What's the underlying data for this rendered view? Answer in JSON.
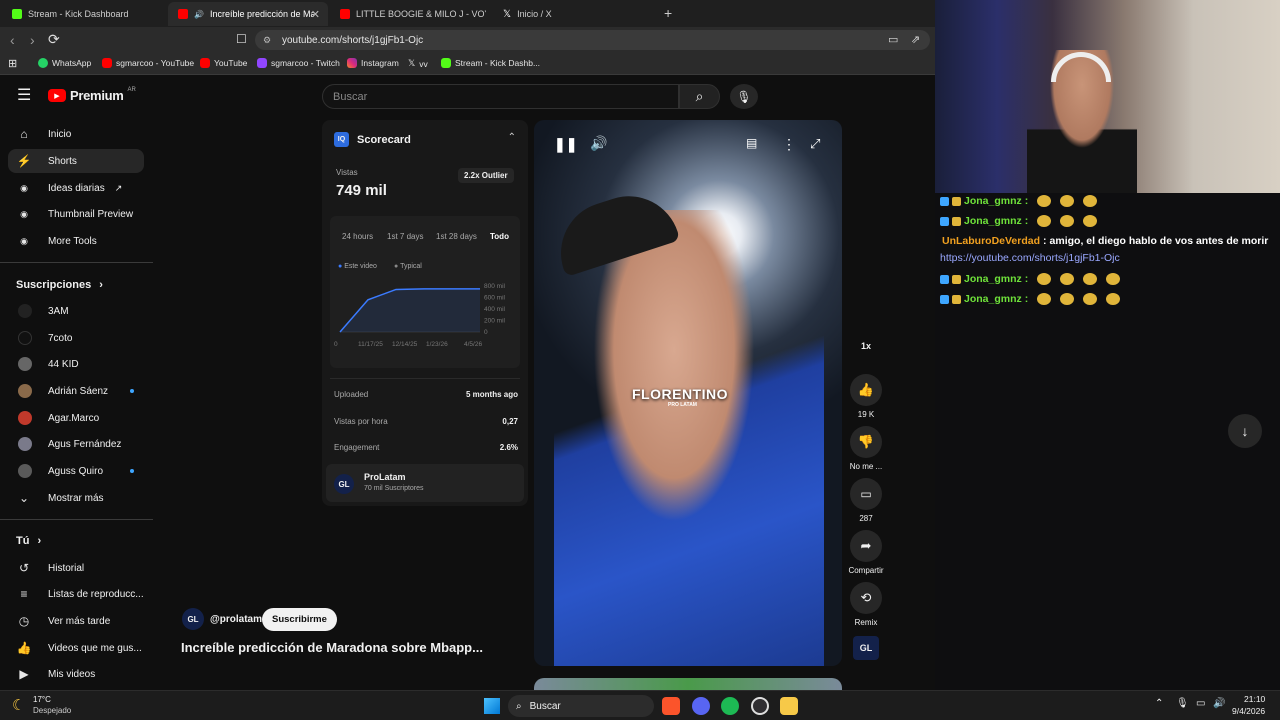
{
  "browser": {
    "tabs": [
      {
        "label": "Stream - Kick Dashboard",
        "color": "#53fc18"
      },
      {
        "label": "Increíble predicción de Marad",
        "color": "#ff0000"
      },
      {
        "label": "LITTLE BOOGIE & MILO J - VOY A DI",
        "color": "#ff0000"
      },
      {
        "label": "Inicio / X",
        "color": "#ffffff"
      }
    ],
    "url": "youtube.com/shorts/j1gjFb1-Ojc",
    "bookmarks": [
      "WhatsApp",
      "sgmarcoo - YouTube",
      "YouTube",
      "sgmarcoo - Twitch",
      "Instagram",
      "vv",
      "Stream - Kick Dashb..."
    ]
  },
  "yt": {
    "logo": "Premium",
    "region": "AR",
    "search_placeholder": "Buscar",
    "nav": [
      {
        "label": "Inicio"
      },
      {
        "label": "Shorts"
      },
      {
        "label": "Ideas diarias"
      },
      {
        "label": "Thumbnail Preview"
      },
      {
        "label": "More Tools"
      }
    ],
    "subs_title": "Suscripciones",
    "subs": [
      {
        "label": "3AM",
        "color": "#222222"
      },
      {
        "label": "7coto",
        "color": "#111111"
      },
      {
        "label": "44 KID",
        "color": "#666666"
      },
      {
        "label": "Adrián Sáenz",
        "color": "#8a6a4a"
      },
      {
        "label": "Agar.Marco",
        "color": "#c0392b"
      },
      {
        "label": "Agus Fernández",
        "color": "#7a7a8a"
      },
      {
        "label": "Aguss Quiro",
        "color": "#5a5a5a"
      }
    ],
    "show_more": "Mostrar más",
    "you_title": "Tú",
    "you": [
      {
        "label": "Historial"
      },
      {
        "label": "Listas de reproducc..."
      },
      {
        "label": "Ver más tarde"
      },
      {
        "label": "Videos que me gus..."
      },
      {
        "label": "Mis videos"
      }
    ]
  },
  "scorecard": {
    "badge": "IQ",
    "title": "Scorecard",
    "views_label": "Vistas",
    "views": "749 mil",
    "outlier": "2.2x Outlier",
    "ranges": [
      "24 hours",
      "1st 7 days",
      "1st 28 days",
      "Todo"
    ],
    "legend": [
      "Este video",
      "Typical"
    ],
    "y_ticks": [
      "800 mil",
      "600 mil",
      "400 mil",
      "200 mil",
      "0"
    ],
    "x_ticks": [
      "0",
      "11/17/25",
      "12/14/25",
      "1/23/26",
      "4/5/26"
    ],
    "stats": [
      {
        "label": "Uploaded",
        "value": "5 months ago"
      },
      {
        "label": "Vistas por hora",
        "value": "0,27"
      },
      {
        "label": "Engagement",
        "value": "2.6%"
      }
    ],
    "channel_name": "ProLatam",
    "channel_subs": "70 mil Suscriptores",
    "channel_logo": "GL"
  },
  "chart_data": {
    "type": "line",
    "series": [
      {
        "name": "Este video",
        "values": [
          0,
          560,
          740,
          749,
          749,
          749
        ]
      }
    ],
    "x": [
      "0",
      "11/17/25",
      "12/14/25",
      "1/23/26",
      "4/5/26"
    ],
    "ylim": [
      0,
      800
    ]
  },
  "video": {
    "overlay_title": "FLORENTINO",
    "overlay_sub": "PRO LATAM",
    "handle": "@prolatam",
    "subscribe": "Suscribirme",
    "title": "Increíble predicción de Maradona sobre Mbapp...",
    "speed": "1x",
    "likes": "19 K",
    "dislike_label": "No me ...",
    "comments": "287",
    "share": "Compartir",
    "remix": "Remix"
  },
  "chat": [
    {
      "user": "Jona_gmnz",
      "message": "",
      "emojis": 3,
      "color": "#6fe23a"
    },
    {
      "user": "Jona_gmnz",
      "message": "",
      "emojis": 3,
      "color": "#6fe23a"
    },
    {
      "user": "UnLaburoDeVerdad",
      "message": "amigo, el diego hablo de vos antes de morir",
      "emojis": 0,
      "color": "#f0a020"
    },
    {
      "link": "https://youtube.com/shorts/j1gjFb1-Ojc"
    },
    {
      "user": "Jona_gmnz",
      "message": "",
      "emojis": 4,
      "color": "#6fe23a"
    },
    {
      "user": "Jona_gmnz",
      "message": "",
      "emojis": 4,
      "color": "#6fe23a"
    }
  ],
  "taskbar": {
    "weather_temp": "17°C",
    "weather_desc": "Despejado",
    "search": "Buscar",
    "time": "21:10",
    "date": "9/4/2026"
  }
}
